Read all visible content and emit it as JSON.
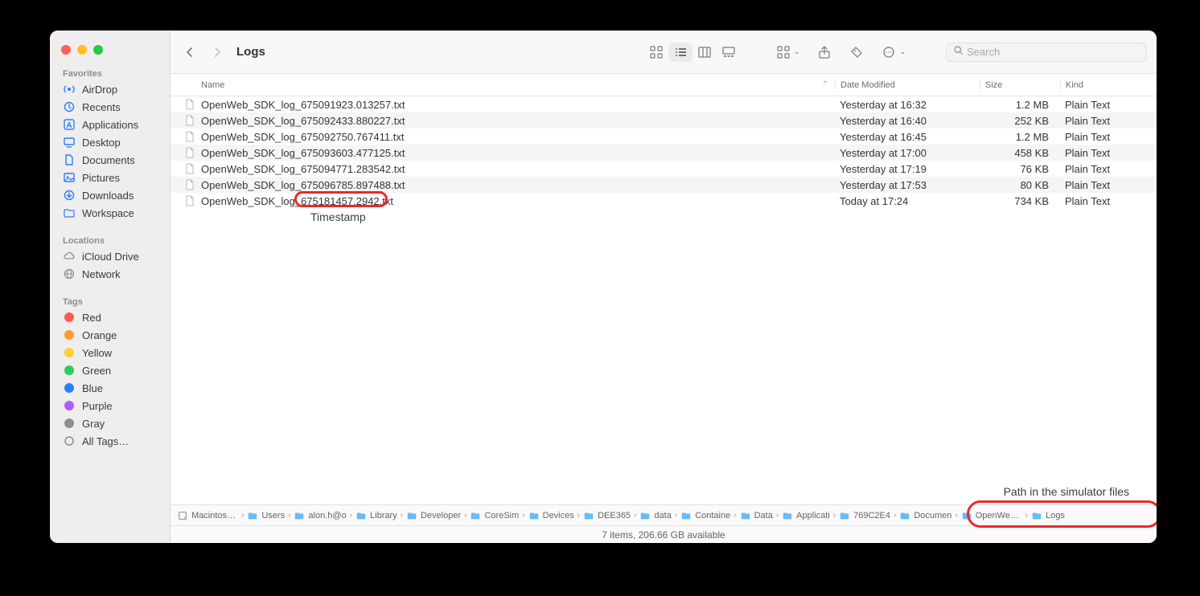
{
  "window_title": "Logs",
  "sidebar": {
    "favorites_label": "Favorites",
    "favorites": [
      {
        "label": "AirDrop",
        "icon": "airdrop"
      },
      {
        "label": "Recents",
        "icon": "clock"
      },
      {
        "label": "Applications",
        "icon": "apps"
      },
      {
        "label": "Desktop",
        "icon": "desktop"
      },
      {
        "label": "Documents",
        "icon": "doc"
      },
      {
        "label": "Pictures",
        "icon": "pictures"
      },
      {
        "label": "Downloads",
        "icon": "downloads"
      },
      {
        "label": "Workspace",
        "icon": "folder"
      }
    ],
    "locations_label": "Locations",
    "locations": [
      {
        "label": "iCloud Drive",
        "icon": "cloud"
      },
      {
        "label": "Network",
        "icon": "globe"
      }
    ],
    "tags_label": "Tags",
    "tags": [
      {
        "label": "Red",
        "color": "#ff5b50"
      },
      {
        "label": "Orange",
        "color": "#ff9c2e"
      },
      {
        "label": "Yellow",
        "color": "#ffd02e"
      },
      {
        "label": "Green",
        "color": "#2ecc59"
      },
      {
        "label": "Blue",
        "color": "#2d7ff9"
      },
      {
        "label": "Purple",
        "color": "#b05bff"
      },
      {
        "label": "Gray",
        "color": "#8e8e8e"
      }
    ],
    "all_tags_label": "All Tags…"
  },
  "columns": {
    "name": "Name",
    "date": "Date Modified",
    "size": "Size",
    "kind": "Kind"
  },
  "files": [
    {
      "name": "OpenWeb_SDK_log_675091923.013257.txt",
      "date": "Yesterday at 16:32",
      "size": "1.2 MB",
      "kind": "Plain Text"
    },
    {
      "name": "OpenWeb_SDK_log_675092433.880227.txt",
      "date": "Yesterday at 16:40",
      "size": "252 KB",
      "kind": "Plain Text"
    },
    {
      "name": "OpenWeb_SDK_log_675092750.767411.txt",
      "date": "Yesterday at 16:45",
      "size": "1.2 MB",
      "kind": "Plain Text"
    },
    {
      "name": "OpenWeb_SDK_log_675093603.477125.txt",
      "date": "Yesterday at 17:00",
      "size": "458 KB",
      "kind": "Plain Text"
    },
    {
      "name": "OpenWeb_SDK_log_675094771.283542.txt",
      "date": "Yesterday at 17:19",
      "size": "76 KB",
      "kind": "Plain Text"
    },
    {
      "name": "OpenWeb_SDK_log_675096785.897488.txt",
      "date": "Yesterday at 17:53",
      "size": "80 KB",
      "kind": "Plain Text"
    },
    {
      "name": "OpenWeb_SDK_log_675181457.2942.txt",
      "date": "Today at 17:24",
      "size": "734 KB",
      "kind": "Plain Text"
    }
  ],
  "search": {
    "placeholder": "Search"
  },
  "annotations": {
    "timestamp_label": "Timestamp",
    "path_label": "Path in the simulator files"
  },
  "pathbar": [
    {
      "label": "Macintosh HD",
      "icon": "disk"
    },
    {
      "label": "Users",
      "icon": "folder"
    },
    {
      "label": "alon.h@o",
      "icon": "folder"
    },
    {
      "label": "Library",
      "icon": "folder"
    },
    {
      "label": "Developer",
      "icon": "folder"
    },
    {
      "label": "CoreSim",
      "icon": "folder"
    },
    {
      "label": "Devices",
      "icon": "folder"
    },
    {
      "label": "DEE365",
      "icon": "folder"
    },
    {
      "label": "data",
      "icon": "folder"
    },
    {
      "label": "Containe",
      "icon": "folder"
    },
    {
      "label": "Data",
      "icon": "folder"
    },
    {
      "label": "Applicati",
      "icon": "folder"
    },
    {
      "label": "769C2E4",
      "icon": "folder"
    },
    {
      "label": "Documen",
      "icon": "folder"
    },
    {
      "label": "OpenWebSdk",
      "icon": "folder"
    },
    {
      "label": "Logs",
      "icon": "folder"
    }
  ],
  "statusbar": "7 items, 206.66 GB available"
}
